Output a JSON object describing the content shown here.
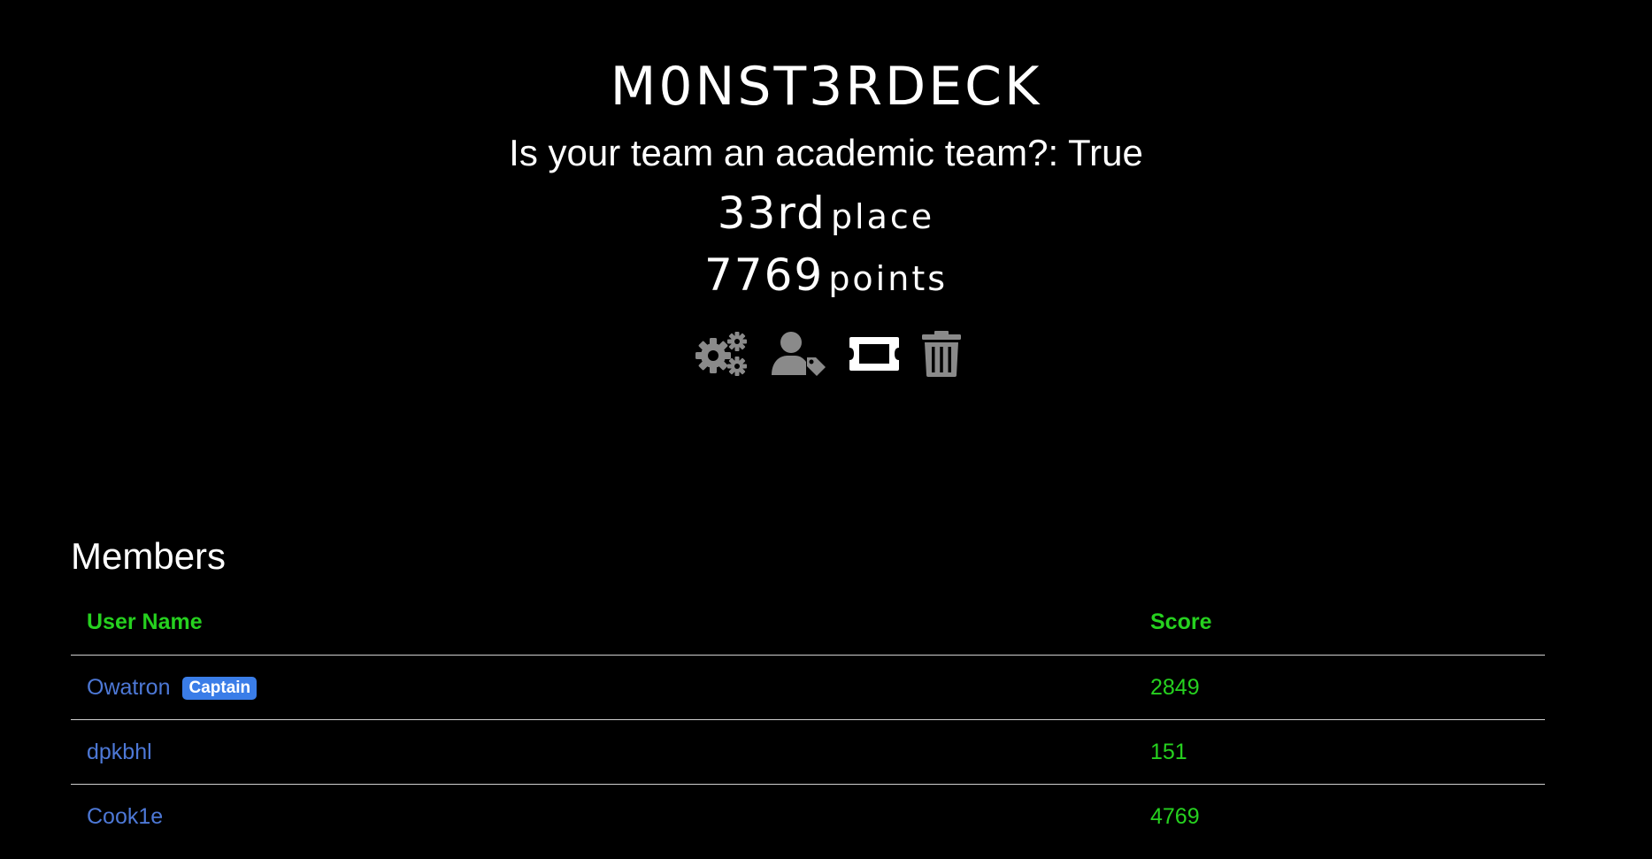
{
  "team": {
    "name": "M0NST3RDECK",
    "academic_text": "Is your team an academic team?: True",
    "place_number": "33rd",
    "place_label": "place",
    "points_number": "7769",
    "points_label": "points"
  },
  "actions": [
    {
      "icon": "gears-icon",
      "color": "#8a8a8a"
    },
    {
      "icon": "user-tag-icon",
      "color": "#8a8a8a"
    },
    {
      "icon": "ticket-icon",
      "color": "#ffffff"
    },
    {
      "icon": "trash-icon",
      "color": "#8a8a8a"
    }
  ],
  "members": {
    "title": "Members",
    "columns": {
      "user": "User Name",
      "score": "Score"
    },
    "rows": [
      {
        "name": "Owatron",
        "badge": "Captain",
        "score": "2849"
      },
      {
        "name": "dpkbhl",
        "badge": "",
        "score": "151"
      },
      {
        "name": "Cook1e",
        "badge": "",
        "score": "4769"
      }
    ]
  },
  "colors": {
    "background": "#000000",
    "accent_green": "#26d11f",
    "link_blue": "#4d78d6",
    "badge_blue": "#3a7de8"
  }
}
